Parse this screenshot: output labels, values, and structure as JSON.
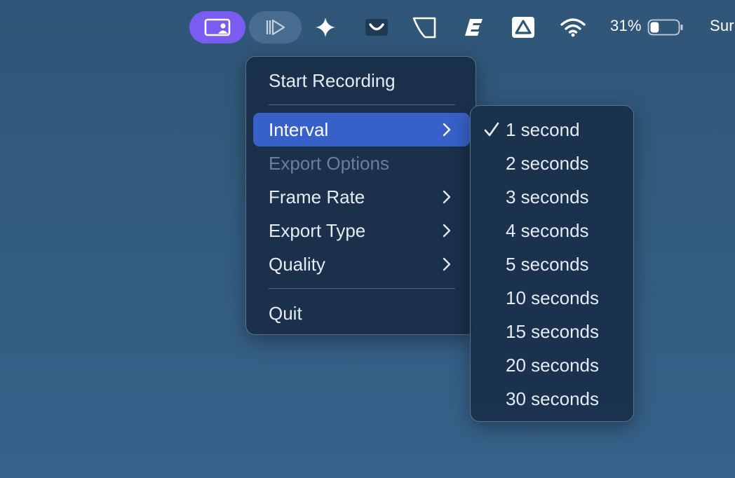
{
  "menubar": {
    "battery_percent": "31%",
    "battery_level": 0.31,
    "clock_partial": "Sur",
    "icons": [
      "screen-recorder-icon",
      "play-step-icon",
      "sparkle-icon",
      "smile-curve-icon",
      "notch-shape-icon",
      "e-logo-icon",
      "drive-icon",
      "wifi-icon",
      "battery-icon"
    ]
  },
  "menu": {
    "start_recording": "Start Recording",
    "interval": "Interval",
    "export_options": "Export Options",
    "frame_rate": "Frame Rate",
    "export_type": "Export Type",
    "quality": "Quality",
    "quit": "Quit"
  },
  "submenu": {
    "checked_index": 0,
    "items": [
      "1 second",
      "2 seconds",
      "3 seconds",
      "4 seconds",
      "5 seconds",
      "10 seconds",
      "15 seconds",
      "20 seconds",
      "30 seconds"
    ]
  },
  "colors": {
    "active_pill": "#7a5cf0",
    "highlight": "#3760c8"
  }
}
